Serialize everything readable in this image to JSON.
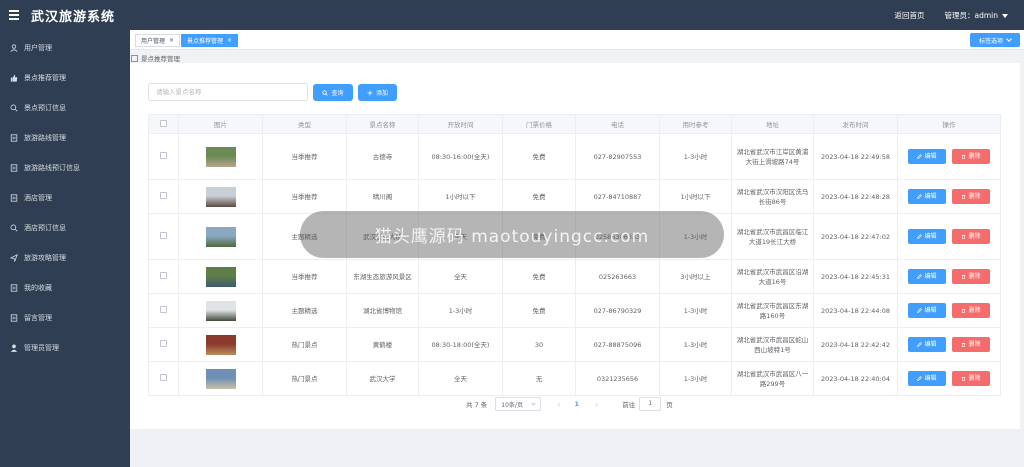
{
  "header": {
    "title": "武汉旅游系统",
    "home_link": "返回首页",
    "admin_label": "管理员：admin"
  },
  "sidebar": {
    "items": [
      {
        "label": "用户管理",
        "icon": "user-icon"
      },
      {
        "label": "景点推荐管理",
        "icon": "thumb-up-icon"
      },
      {
        "label": "景点预订信息",
        "icon": "search-icon"
      },
      {
        "label": "旅游路线管理",
        "icon": "document-icon"
      },
      {
        "label": "旅游路线预订信息",
        "icon": "document-icon"
      },
      {
        "label": "酒店管理",
        "icon": "document-icon"
      },
      {
        "label": "酒店预订信息",
        "icon": "search-icon"
      },
      {
        "label": "旅游攻略管理",
        "icon": "send-icon"
      },
      {
        "label": "我的收藏",
        "icon": "document-icon"
      },
      {
        "label": "留言管理",
        "icon": "document-icon"
      },
      {
        "label": "管理员管理",
        "icon": "user-filled-icon"
      }
    ]
  },
  "tabs": {
    "items": [
      {
        "label": "用户管理",
        "close": "×"
      },
      {
        "label": "景点推荐管理",
        "close": "×"
      }
    ],
    "options_label": "标签选项"
  },
  "breadcrumb": "景点推荐管理",
  "toolbar": {
    "search_placeholder": "请输入景点名称",
    "search_label": "查询",
    "add_label": "添加"
  },
  "table": {
    "columns": [
      "图片",
      "类型",
      "景点名称",
      "开放时间",
      "门票价格",
      "电话",
      "用时参考",
      "地址",
      "发布时间",
      "操作"
    ],
    "edit_label": "编辑",
    "delete_label": "删除",
    "rows": [
      {
        "type": "当季推荐",
        "name": "古德寺",
        "open": "08:30-16:00(全天)",
        "price": "免费",
        "phone": "027-82907553",
        "duration": "1-3小时",
        "address": "湖北省武汉市江岸区黄浦大街上滑坡路74号",
        "time": "2023-04-18 22:49:58",
        "thumb": [
          "#6c8a55",
          "#b9a68c"
        ]
      },
      {
        "type": "当季推荐",
        "name": "晴川阁",
        "open": "1小时以下",
        "price": "免费",
        "phone": "027-84710887",
        "duration": "1小时以下",
        "address": "湖北省武汉市汉阳区洗马长街86号",
        "time": "2023-04-18 22:48:28",
        "thumb": [
          "#c9cfd6",
          "#5a4a40"
        ]
      },
      {
        "type": "主题精选",
        "name": "武汉长江大桥",
        "open": "全天",
        "price": "免费",
        "phone": "02586306333",
        "duration": "1-3小时",
        "address": "湖北省武汉市武昌区临江大道19长江大桥",
        "time": "2023-04-18 22:47:02",
        "thumb": [
          "#8aa7c2",
          "#4f6a3c"
        ]
      },
      {
        "type": "当季推荐",
        "name": "东湖生态旅游风景区",
        "open": "全天",
        "price": "免费",
        "phone": "025263663",
        "duration": "3小时以上",
        "address": "湖北省武汉市武昌区沿湖大道16号",
        "time": "2023-04-18 22:45:31",
        "thumb": [
          "#5f7d48",
          "#3d5a6e"
        ]
      },
      {
        "type": "主题精选",
        "name": "湖北省博物馆",
        "open": "1-3小时",
        "price": "免费",
        "phone": "027-86790329",
        "duration": "1-3小时",
        "address": "湖北省武汉市武昌区东湖路160号",
        "time": "2023-04-18 22:44:08",
        "thumb": [
          "#dfe3e6",
          "#3f4a3a"
        ]
      },
      {
        "type": "热门景点",
        "name": "黄鹤楼",
        "open": "08:30-18:00(全天)",
        "price": "30",
        "phone": "027-88875096",
        "duration": "1-3小时",
        "address": "湖北省武汉市武昌区蛇山西山坡特1号",
        "time": "2023-04-18 22:42:42",
        "thumb": [
          "#8a3a2c",
          "#b98e5e"
        ]
      },
      {
        "type": "热门景点",
        "name": "武汉大学",
        "open": "全天",
        "price": "无",
        "phone": "0321235656",
        "duration": "1-3小时",
        "address": "湖北省武汉市武昌区八一路299号",
        "time": "2023-04-18 22:40:04",
        "thumb": [
          "#6f8fb6",
          "#c8c0a8"
        ]
      }
    ]
  },
  "pagination": {
    "total": "共 7 条",
    "page_size": "10条/页",
    "prev": "‹",
    "current": "1",
    "next": "›",
    "goto_label": "前往",
    "goto_value": "1",
    "page_suffix": "页"
  },
  "watermark": "猫头鹰源码 maotouyingcc.com"
}
